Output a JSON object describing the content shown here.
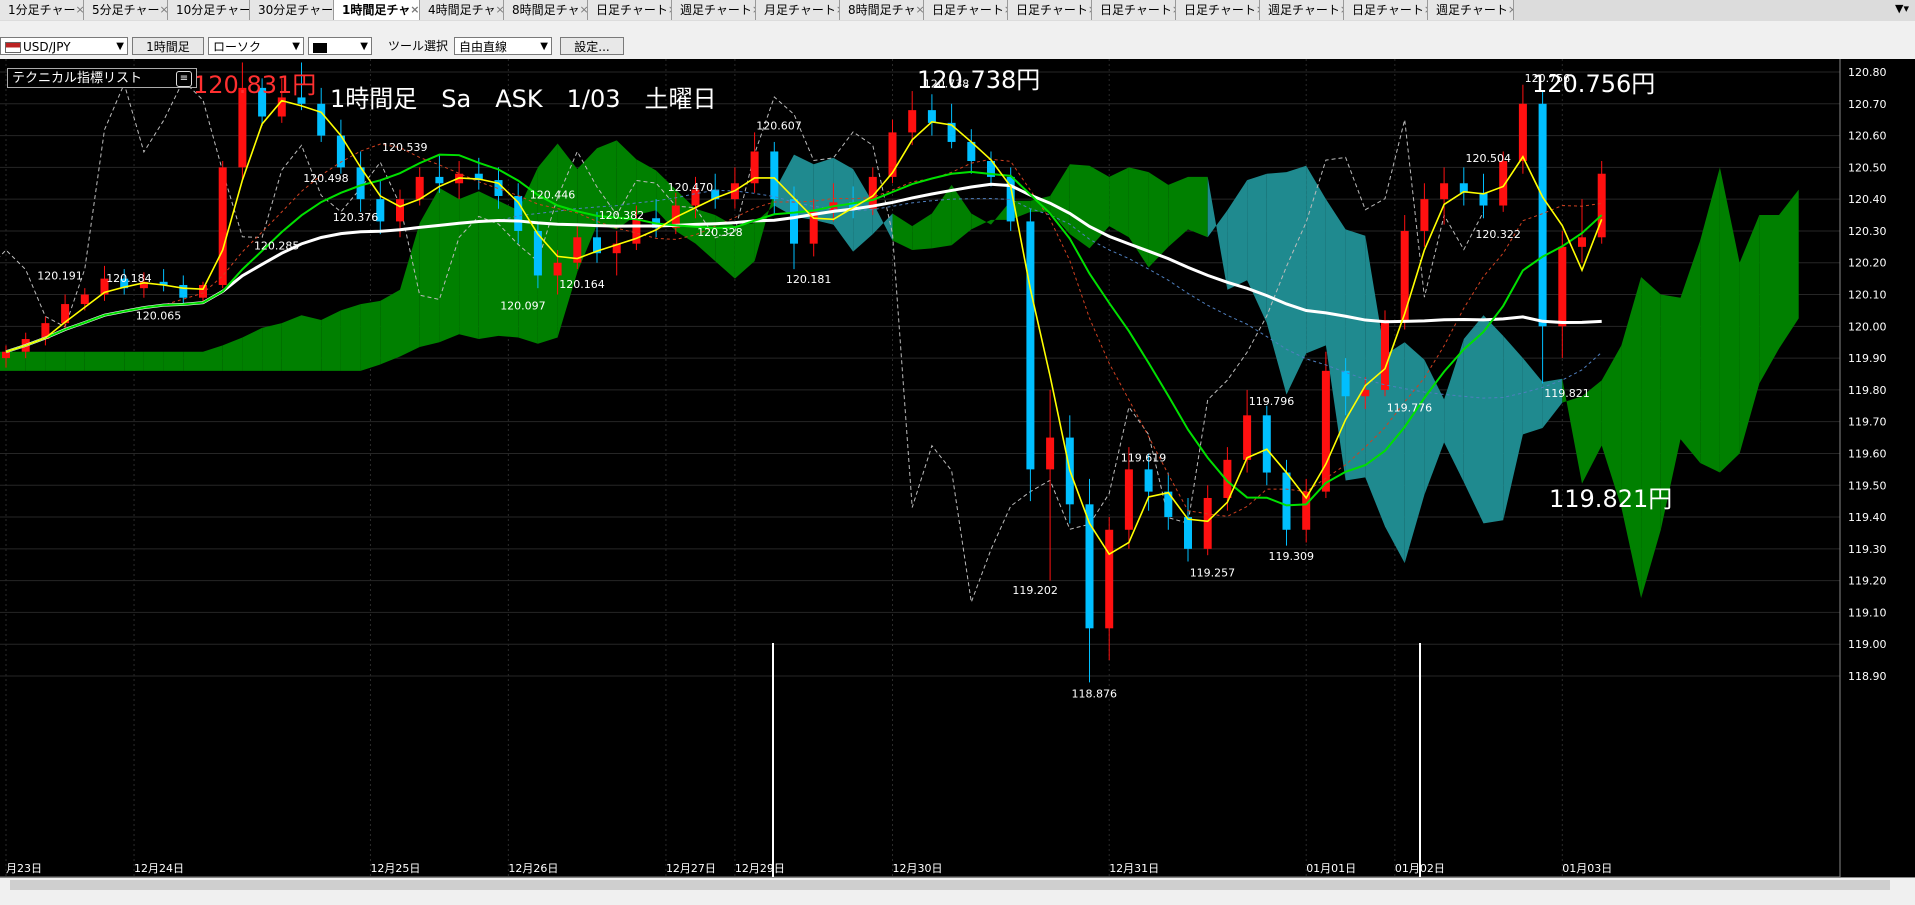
{
  "tabs": [
    {
      "label": "1分足チャー",
      "active": false
    },
    {
      "label": "5分足チャー",
      "active": false
    },
    {
      "label": "10分足チャー",
      "active": false
    },
    {
      "label": "30分足チャー",
      "active": false
    },
    {
      "label": "1時間足チャ",
      "active": true
    },
    {
      "label": "4時間足チャ",
      "active": false
    },
    {
      "label": "8時間足チャ",
      "active": false
    },
    {
      "label": "日足チャート",
      "active": false
    },
    {
      "label": "週足チャート",
      "active": false
    },
    {
      "label": "月足チャート",
      "active": false
    },
    {
      "label": "8時間足チャ",
      "active": false
    },
    {
      "label": "日足チャート",
      "active": false
    },
    {
      "label": "日足チャート",
      "active": false
    },
    {
      "label": "日足チャート",
      "active": false
    },
    {
      "label": "日足チャート",
      "active": false
    },
    {
      "label": "週足チャート",
      "active": false
    },
    {
      "label": "日足チャート",
      "active": false
    },
    {
      "label": "週足チャート",
      "active": false
    }
  ],
  "toolbar": {
    "symbol": "USD/JPY",
    "timeframe": "1時間足",
    "chart_style": "ローソク",
    "color_select": "",
    "tool_label": "ツール選択",
    "tool_value": "自由直線",
    "settings_button": "設定..."
  },
  "indicator_list_label": "テクニカル指標リスト",
  "annotations": {
    "header": "1時間足　Sa　ASK　1/03　土曜日",
    "high_left": "120.831円",
    "high_mid": "120.738円",
    "high_right": "120.756円",
    "low_right": "119.821円",
    "low_bottom": "118.876円"
  },
  "chart_data": {
    "type": "candlestick",
    "symbol": "USD/JPY",
    "y_axis_ticks": [
      "120.80",
      "120.70",
      "120.60",
      "120.50",
      "120.40",
      "120.30",
      "120.20",
      "120.10",
      "120.00",
      "119.90",
      "119.80",
      "119.70",
      "119.60",
      "119.50",
      "119.40",
      "119.30",
      "119.20",
      "119.10",
      "119.00",
      "118.90"
    ],
    "x_axis_labels": [
      {
        "label": "月23日",
        "x": 0
      },
      {
        "label": "12月24日",
        "x": 6.5
      },
      {
        "label": "12月25日",
        "x": 18.5
      },
      {
        "label": "12月26日",
        "x": 25.5
      },
      {
        "label": "12月27日",
        "x": 33.5
      },
      {
        "label": "12月29日",
        "x": 37
      },
      {
        "label": "12月30日",
        "x": 45
      },
      {
        "label": "12月31日",
        "x": 56
      },
      {
        "label": "01月01日",
        "x": 66
      },
      {
        "label": "01月02日",
        "x": 70.5
      },
      {
        "label": "01月03日",
        "x": 79
      }
    ],
    "price_labels": [
      {
        "text": "120.830",
        "x": 8,
        "y": 120.83
      },
      {
        "text": "120.831",
        "x": 10.5,
        "y": 120.831
      },
      {
        "text": "120.191",
        "x": 2.5,
        "y": 120.191
      },
      {
        "text": "120.184",
        "x": 6,
        "y": 120.184
      },
      {
        "text": "120.065",
        "x": 7.5,
        "y": 120.065
      },
      {
        "text": "120.498",
        "x": 16,
        "y": 120.498
      },
      {
        "text": "120.539",
        "x": 20,
        "y": 120.539
      },
      {
        "text": "120.376",
        "x": 17.5,
        "y": 120.376
      },
      {
        "text": "120.285",
        "x": 13.5,
        "y": 120.285
      },
      {
        "text": "120.446",
        "x": 27.5,
        "y": 120.446
      },
      {
        "text": "120.097",
        "x": 26,
        "y": 120.097
      },
      {
        "text": "120.382",
        "x": 31,
        "y": 120.382
      },
      {
        "text": "120.164",
        "x": 29,
        "y": 120.164
      },
      {
        "text": "120.470",
        "x": 34.5,
        "y": 120.47
      },
      {
        "text": "120.328",
        "x": 36,
        "y": 120.328
      },
      {
        "text": "120.607",
        "x": 39,
        "y": 120.607
      },
      {
        "text": "120.181",
        "x": 40.5,
        "y": 120.181
      },
      {
        "text": "120.738",
        "x": 47.5,
        "y": 120.738
      },
      {
        "text": "119.202",
        "x": 52,
        "y": 119.202
      },
      {
        "text": "119.619",
        "x": 57.5,
        "y": 119.619
      },
      {
        "text": "118.876",
        "x": 55,
        "y": 118.876
      },
      {
        "text": "119.257",
        "x": 61,
        "y": 119.257
      },
      {
        "text": "119.796",
        "x": 64,
        "y": 119.796
      },
      {
        "text": "119.309",
        "x": 65,
        "y": 119.309
      },
      {
        "text": "119.776",
        "x": 71,
        "y": 119.776
      },
      {
        "text": "120.504",
        "x": 75,
        "y": 120.504
      },
      {
        "text": "120.322",
        "x": 75.5,
        "y": 120.322
      },
      {
        "text": "120.756",
        "x": 78,
        "y": 120.756
      },
      {
        "text": "119.821",
        "x": 79,
        "y": 119.821
      }
    ],
    "candles": [
      [
        119.9,
        119.94,
        119.87,
        119.92
      ],
      [
        119.92,
        119.98,
        119.9,
        119.96
      ],
      [
        119.96,
        120.03,
        119.94,
        120.01
      ],
      [
        120.01,
        120.1,
        119.99,
        120.07
      ],
      [
        120.07,
        120.12,
        120.05,
        120.1
      ],
      [
        120.1,
        120.19,
        120.08,
        120.15
      ],
      [
        120.15,
        120.18,
        120.1,
        120.12
      ],
      [
        120.12,
        120.17,
        120.09,
        120.14
      ],
      [
        120.14,
        120.18,
        120.11,
        120.13
      ],
      [
        120.13,
        120.16,
        120.07,
        120.09
      ],
      [
        120.09,
        120.14,
        120.07,
        120.13
      ],
      [
        120.13,
        120.52,
        120.12,
        120.5
      ],
      [
        120.5,
        120.83,
        120.46,
        120.75
      ],
      [
        120.75,
        120.78,
        120.63,
        120.66
      ],
      [
        120.66,
        120.78,
        120.64,
        120.72
      ],
      [
        120.72,
        120.83,
        120.68,
        120.7
      ],
      [
        120.7,
        120.75,
        120.58,
        120.6
      ],
      [
        120.6,
        120.65,
        120.48,
        120.5
      ],
      [
        120.5,
        120.55,
        120.36,
        120.4
      ],
      [
        120.4,
        120.46,
        120.29,
        120.33
      ],
      [
        120.33,
        120.43,
        120.28,
        120.4
      ],
      [
        120.4,
        120.5,
        120.38,
        120.47
      ],
      [
        120.47,
        120.54,
        120.42,
        120.45
      ],
      [
        120.45,
        120.52,
        120.4,
        120.48
      ],
      [
        120.48,
        120.53,
        120.43,
        120.46
      ],
      [
        120.46,
        120.5,
        120.37,
        120.41
      ],
      [
        120.41,
        120.45,
        120.26,
        120.3
      ],
      [
        120.3,
        120.33,
        120.12,
        120.16
      ],
      [
        120.16,
        120.24,
        120.1,
        120.2
      ],
      [
        120.2,
        120.32,
        120.18,
        120.28
      ],
      [
        120.28,
        120.36,
        120.2,
        120.23
      ],
      [
        120.23,
        120.3,
        120.16,
        120.26
      ],
      [
        120.26,
        120.38,
        120.24,
        120.34
      ],
      [
        120.34,
        120.4,
        120.28,
        120.31
      ],
      [
        120.31,
        120.42,
        120.29,
        120.38
      ],
      [
        120.38,
        120.47,
        120.34,
        120.43
      ],
      [
        120.43,
        120.48,
        120.37,
        120.4
      ],
      [
        120.4,
        120.5,
        120.37,
        120.45
      ],
      [
        120.45,
        120.61,
        120.42,
        120.55
      ],
      [
        120.55,
        120.58,
        120.35,
        120.4
      ],
      [
        120.4,
        120.44,
        120.18,
        120.26
      ],
      [
        120.26,
        120.4,
        120.22,
        120.36
      ],
      [
        120.36,
        120.45,
        120.33,
        120.39
      ],
      [
        120.39,
        120.44,
        120.34,
        120.37
      ],
      [
        120.37,
        120.5,
        120.35,
        120.47
      ],
      [
        120.47,
        120.65,
        120.45,
        120.61
      ],
      [
        120.61,
        120.74,
        120.57,
        120.68
      ],
      [
        120.68,
        120.73,
        120.6,
        120.64
      ],
      [
        120.64,
        120.7,
        120.56,
        120.58
      ],
      [
        120.58,
        120.62,
        120.48,
        120.52
      ],
      [
        120.52,
        120.55,
        120.44,
        120.47
      ],
      [
        120.47,
        120.5,
        120.3,
        120.33
      ],
      [
        120.33,
        120.37,
        119.45,
        119.55
      ],
      [
        119.55,
        119.8,
        119.2,
        119.65
      ],
      [
        119.65,
        119.72,
        119.38,
        119.44
      ],
      [
        119.44,
        119.52,
        118.88,
        119.05
      ],
      [
        119.05,
        119.4,
        118.95,
        119.36
      ],
      [
        119.36,
        119.62,
        119.3,
        119.55
      ],
      [
        119.55,
        119.6,
        119.42,
        119.48
      ],
      [
        119.48,
        119.54,
        119.36,
        119.4
      ],
      [
        119.4,
        119.46,
        119.26,
        119.3
      ],
      [
        119.3,
        119.5,
        119.28,
        119.46
      ],
      [
        119.46,
        119.62,
        119.42,
        119.58
      ],
      [
        119.58,
        119.8,
        119.54,
        119.72
      ],
      [
        119.72,
        119.75,
        119.5,
        119.54
      ],
      [
        119.54,
        119.58,
        119.31,
        119.36
      ],
      [
        119.36,
        119.52,
        119.32,
        119.48
      ],
      [
        119.48,
        119.92,
        119.46,
        119.86
      ],
      [
        119.86,
        119.9,
        119.72,
        119.78
      ],
      [
        119.78,
        119.84,
        119.74,
        119.8
      ],
      [
        119.8,
        120.05,
        119.78,
        120.02
      ],
      [
        120.02,
        120.35,
        119.99,
        120.3
      ],
      [
        120.3,
        120.45,
        120.25,
        120.4
      ],
      [
        120.4,
        120.5,
        120.32,
        120.45
      ],
      [
        120.45,
        120.5,
        120.38,
        120.42
      ],
      [
        120.42,
        120.48,
        120.34,
        120.38
      ],
      [
        120.38,
        120.55,
        120.36,
        120.52
      ],
      [
        120.52,
        120.76,
        120.48,
        120.7
      ],
      [
        120.7,
        120.74,
        119.82,
        120.0
      ],
      [
        120.0,
        120.3,
        119.9,
        120.25
      ],
      [
        120.25,
        120.4,
        120.2,
        120.28
      ],
      [
        120.28,
        120.52,
        120.26,
        120.48
      ]
    ],
    "colors": {
      "up": "#ff1010",
      "down": "#00bfff",
      "sma_fast": "#ffff00",
      "sma_mid": "#00e000",
      "sma_long": "#ffffff",
      "kumo_a": "#008000",
      "kumo_b": "#1f8a8f",
      "lagging": "#bbbbbb"
    }
  }
}
